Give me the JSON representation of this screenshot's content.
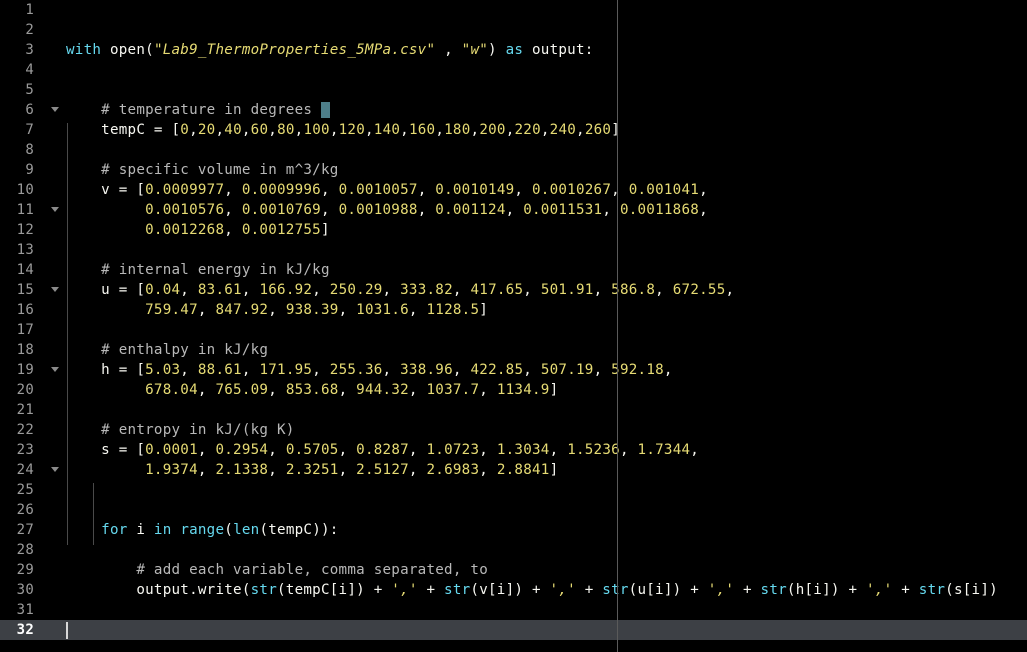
{
  "editor": {
    "current_line": 32,
    "fold_lines": [
      6,
      11,
      15,
      19,
      24
    ],
    "lines": [
      {
        "n": "1",
        "t": []
      },
      {
        "n": "2",
        "t": []
      },
      {
        "n": "3",
        "t": [
          [
            "kw",
            "with "
          ],
          [
            "pl",
            "open("
          ],
          [
            "st",
            "\"Lab9_ThermoProperties_5MPa.csv\""
          ],
          [
            "pl",
            " , "
          ],
          [
            "st",
            "\"w\""
          ],
          [
            "pl",
            ") "
          ],
          [
            "kw",
            "as"
          ],
          [
            "pl",
            " output:"
          ]
        ]
      },
      {
        "n": "4",
        "t": []
      },
      {
        "n": "5",
        "t": []
      },
      {
        "n": "6",
        "t": [
          [
            "pl",
            "    "
          ],
          [
            "co",
            "# temperature in degrees "
          ],
          [
            "sel",
            "C"
          ]
        ]
      },
      {
        "n": "7",
        "t": [
          [
            "pl",
            "    tempC = ["
          ],
          [
            "nu",
            "0"
          ],
          [
            "pl",
            ","
          ],
          [
            "nu",
            "20"
          ],
          [
            "pl",
            ","
          ],
          [
            "nu",
            "40"
          ],
          [
            "pl",
            ","
          ],
          [
            "nu",
            "60"
          ],
          [
            "pl",
            ","
          ],
          [
            "nu",
            "80"
          ],
          [
            "pl",
            ","
          ],
          [
            "nu",
            "100"
          ],
          [
            "pl",
            ","
          ],
          [
            "nu",
            "120"
          ],
          [
            "pl",
            ","
          ],
          [
            "nu",
            "140"
          ],
          [
            "pl",
            ","
          ],
          [
            "nu",
            "160"
          ],
          [
            "pl",
            ","
          ],
          [
            "nu",
            "180"
          ],
          [
            "pl",
            ","
          ],
          [
            "nu",
            "200"
          ],
          [
            "pl",
            ","
          ],
          [
            "nu",
            "220"
          ],
          [
            "pl",
            ","
          ],
          [
            "nu",
            "240"
          ],
          [
            "pl",
            ","
          ],
          [
            "nu",
            "260"
          ],
          [
            "pl",
            "]"
          ]
        ]
      },
      {
        "n": "8",
        "t": []
      },
      {
        "n": "9",
        "t": [
          [
            "pl",
            "    "
          ],
          [
            "co",
            "# specific volume in m^3/kg"
          ]
        ]
      },
      {
        "n": "10",
        "t": [
          [
            "pl",
            "    v = ["
          ],
          [
            "nu",
            "0.0009977"
          ],
          [
            "pl",
            ", "
          ],
          [
            "nu",
            "0.0009996"
          ],
          [
            "pl",
            ", "
          ],
          [
            "nu",
            "0.0010057"
          ],
          [
            "pl",
            ", "
          ],
          [
            "nu",
            "0.0010149"
          ],
          [
            "pl",
            ", "
          ],
          [
            "nu",
            "0.0010267"
          ],
          [
            "pl",
            ", "
          ],
          [
            "nu",
            "0.001041"
          ],
          [
            "pl",
            ","
          ]
        ]
      },
      {
        "n": "11",
        "t": [
          [
            "pl",
            "         "
          ],
          [
            "nu",
            "0.0010576"
          ],
          [
            "pl",
            ", "
          ],
          [
            "nu",
            "0.0010769"
          ],
          [
            "pl",
            ", "
          ],
          [
            "nu",
            "0.0010988"
          ],
          [
            "pl",
            ", "
          ],
          [
            "nu",
            "0.001124"
          ],
          [
            "pl",
            ", "
          ],
          [
            "nu",
            "0.0011531"
          ],
          [
            "pl",
            ", "
          ],
          [
            "nu",
            "0.0011868"
          ],
          [
            "pl",
            ","
          ]
        ]
      },
      {
        "n": "12",
        "t": [
          [
            "pl",
            "         "
          ],
          [
            "nu",
            "0.0012268"
          ],
          [
            "pl",
            ", "
          ],
          [
            "nu",
            "0.0012755"
          ],
          [
            "pl",
            "]"
          ]
        ]
      },
      {
        "n": "13",
        "t": []
      },
      {
        "n": "14",
        "t": [
          [
            "pl",
            "    "
          ],
          [
            "co",
            "# internal energy in kJ/kg"
          ]
        ]
      },
      {
        "n": "15",
        "t": [
          [
            "pl",
            "    u = ["
          ],
          [
            "nu",
            "0.04"
          ],
          [
            "pl",
            ", "
          ],
          [
            "nu",
            "83.61"
          ],
          [
            "pl",
            ", "
          ],
          [
            "nu",
            "166.92"
          ],
          [
            "pl",
            ", "
          ],
          [
            "nu",
            "250.29"
          ],
          [
            "pl",
            ", "
          ],
          [
            "nu",
            "333.82"
          ],
          [
            "pl",
            ", "
          ],
          [
            "nu",
            "417.65"
          ],
          [
            "pl",
            ", "
          ],
          [
            "nu",
            "501.91"
          ],
          [
            "pl",
            ", "
          ],
          [
            "nu",
            "586.8"
          ],
          [
            "pl",
            ", "
          ],
          [
            "nu",
            "672.55"
          ],
          [
            "pl",
            ","
          ]
        ]
      },
      {
        "n": "16",
        "t": [
          [
            "pl",
            "         "
          ],
          [
            "nu",
            "759.47"
          ],
          [
            "pl",
            ", "
          ],
          [
            "nu",
            "847.92"
          ],
          [
            "pl",
            ", "
          ],
          [
            "nu",
            "938.39"
          ],
          [
            "pl",
            ", "
          ],
          [
            "nu",
            "1031.6"
          ],
          [
            "pl",
            ", "
          ],
          [
            "nu",
            "1128.5"
          ],
          [
            "pl",
            "]"
          ]
        ]
      },
      {
        "n": "17",
        "t": []
      },
      {
        "n": "18",
        "t": [
          [
            "pl",
            "    "
          ],
          [
            "co",
            "# enthalpy in kJ/kg"
          ]
        ]
      },
      {
        "n": "19",
        "t": [
          [
            "pl",
            "    h = ["
          ],
          [
            "nu",
            "5.03"
          ],
          [
            "pl",
            ", "
          ],
          [
            "nu",
            "88.61"
          ],
          [
            "pl",
            ", "
          ],
          [
            "nu",
            "171.95"
          ],
          [
            "pl",
            ", "
          ],
          [
            "nu",
            "255.36"
          ],
          [
            "pl",
            ", "
          ],
          [
            "nu",
            "338.96"
          ],
          [
            "pl",
            ", "
          ],
          [
            "nu",
            "422.85"
          ],
          [
            "pl",
            ", "
          ],
          [
            "nu",
            "507.19"
          ],
          [
            "pl",
            ", "
          ],
          [
            "nu",
            "592.18"
          ],
          [
            "pl",
            ","
          ]
        ]
      },
      {
        "n": "20",
        "t": [
          [
            "pl",
            "         "
          ],
          [
            "nu",
            "678.04"
          ],
          [
            "pl",
            ", "
          ],
          [
            "nu",
            "765.09"
          ],
          [
            "pl",
            ", "
          ],
          [
            "nu",
            "853.68"
          ],
          [
            "pl",
            ", "
          ],
          [
            "nu",
            "944.32"
          ],
          [
            "pl",
            ", "
          ],
          [
            "nu",
            "1037.7"
          ],
          [
            "pl",
            ", "
          ],
          [
            "nu",
            "1134.9"
          ],
          [
            "pl",
            "]"
          ]
        ]
      },
      {
        "n": "21",
        "t": []
      },
      {
        "n": "22",
        "t": [
          [
            "pl",
            "    "
          ],
          [
            "co",
            "# entropy in kJ/(kg K)"
          ]
        ]
      },
      {
        "n": "23",
        "t": [
          [
            "pl",
            "    s = ["
          ],
          [
            "nu",
            "0.0001"
          ],
          [
            "pl",
            ", "
          ],
          [
            "nu",
            "0.2954"
          ],
          [
            "pl",
            ", "
          ],
          [
            "nu",
            "0.5705"
          ],
          [
            "pl",
            ", "
          ],
          [
            "nu",
            "0.8287"
          ],
          [
            "pl",
            ", "
          ],
          [
            "nu",
            "1.0723"
          ],
          [
            "pl",
            ", "
          ],
          [
            "nu",
            "1.3034"
          ],
          [
            "pl",
            ", "
          ],
          [
            "nu",
            "1.5236"
          ],
          [
            "pl",
            ", "
          ],
          [
            "nu",
            "1.7344"
          ],
          [
            "pl",
            ","
          ]
        ]
      },
      {
        "n": "24",
        "t": [
          [
            "pl",
            "         "
          ],
          [
            "nu",
            "1.9374"
          ],
          [
            "pl",
            ", "
          ],
          [
            "nu",
            "2.1338"
          ],
          [
            "pl",
            ", "
          ],
          [
            "nu",
            "2.3251"
          ],
          [
            "pl",
            ", "
          ],
          [
            "nu",
            "2.5127"
          ],
          [
            "pl",
            ", "
          ],
          [
            "nu",
            "2.6983"
          ],
          [
            "pl",
            ", "
          ],
          [
            "nu",
            "2.8841"
          ],
          [
            "pl",
            "]"
          ]
        ]
      },
      {
        "n": "25",
        "t": []
      },
      {
        "n": "26",
        "t": []
      },
      {
        "n": "27",
        "t": [
          [
            "pl",
            "    "
          ],
          [
            "kw",
            "for"
          ],
          [
            "pl",
            " i "
          ],
          [
            "kw",
            "in"
          ],
          [
            "pl",
            " "
          ],
          [
            "kw",
            "range"
          ],
          [
            "pl",
            "("
          ],
          [
            "kw",
            "len"
          ],
          [
            "pl",
            "(tempC)):"
          ]
        ]
      },
      {
        "n": "28",
        "t": []
      },
      {
        "n": "29",
        "t": [
          [
            "pl",
            "        "
          ],
          [
            "co",
            "# add each variable, comma separated, to"
          ]
        ]
      },
      {
        "n": "30",
        "t": [
          [
            "pl",
            "        output.write("
          ],
          [
            "kw",
            "str"
          ],
          [
            "pl",
            "(tempC[i]) + "
          ],
          [
            "st",
            "','"
          ],
          [
            "pl",
            " + "
          ],
          [
            "kw",
            "str"
          ],
          [
            "pl",
            "(v[i]) + "
          ],
          [
            "st",
            "','"
          ],
          [
            "pl",
            " + "
          ],
          [
            "kw",
            "str"
          ],
          [
            "pl",
            "(u[i]) + "
          ],
          [
            "st",
            "','"
          ],
          [
            "pl",
            " + "
          ],
          [
            "kw",
            "str"
          ],
          [
            "pl",
            "(h[i]) + "
          ],
          [
            "st",
            "','"
          ],
          [
            "pl",
            " + "
          ],
          [
            "kw",
            "str"
          ],
          [
            "pl",
            "(s[i])"
          ]
        ]
      },
      {
        "n": "31",
        "t": []
      },
      {
        "n": "32",
        "t": []
      }
    ]
  },
  "colors": {
    "background": "#000000",
    "keyword": "#66d9ef",
    "string": "#e6db74",
    "number": "#e6db74",
    "comment": "#b8b8b8",
    "text": "#f8f8f2",
    "current_line": "#3d4045"
  }
}
